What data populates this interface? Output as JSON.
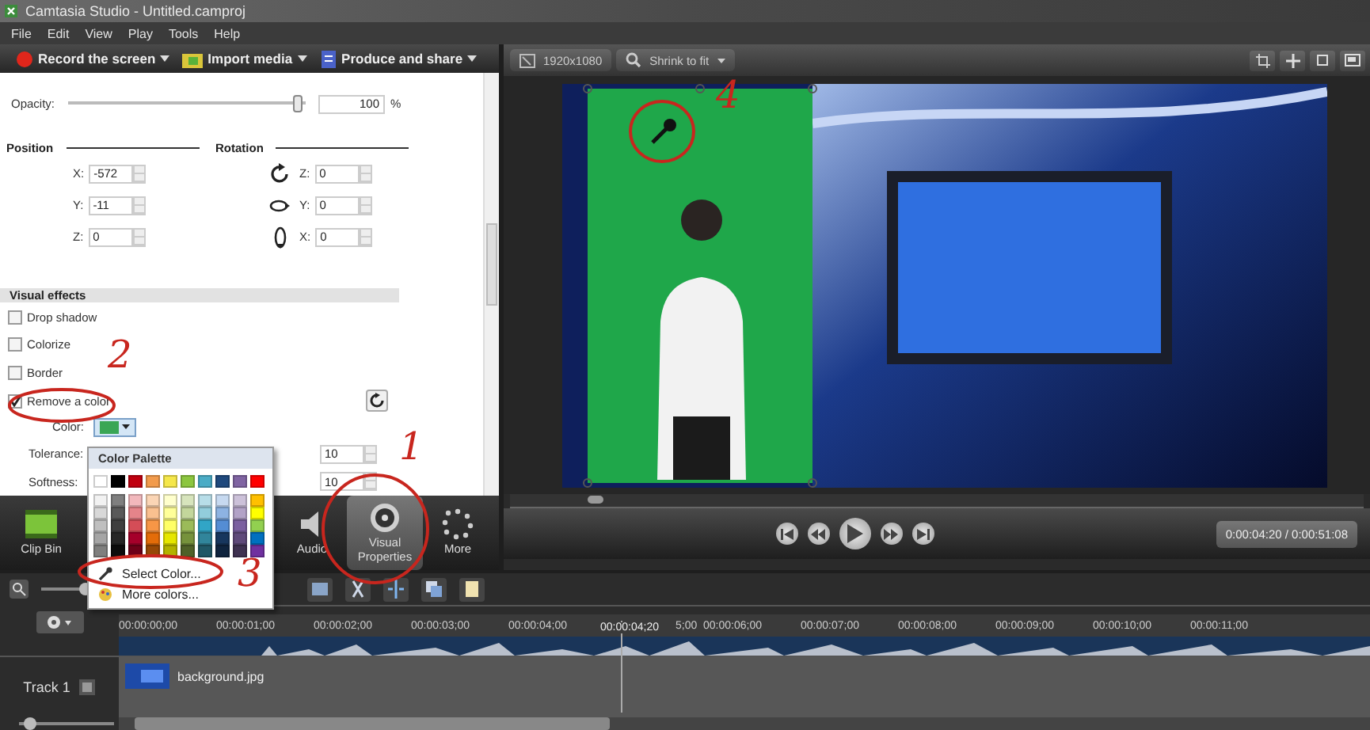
{
  "window": {
    "title": "Camtasia Studio - Untitled.camproj"
  },
  "menu": [
    "File",
    "Edit",
    "View",
    "Play",
    "Tools",
    "Help"
  ],
  "toolbar": [
    {
      "label": "Record the screen",
      "kind": "record"
    },
    {
      "label": "Import media",
      "kind": "import"
    },
    {
      "label": "Produce and share",
      "kind": "produce"
    }
  ],
  "properties": {
    "opacity": {
      "label": "Opacity:",
      "level": 0.97,
      "value": "100",
      "unit": "%"
    },
    "position": {
      "title": "Position",
      "fields": [
        {
          "axis": "X:",
          "value": "-572"
        },
        {
          "axis": "Y:",
          "value": "-11"
        },
        {
          "axis": "Z:",
          "value": "0"
        }
      ]
    },
    "rotation": {
      "title": "Rotation",
      "fields": [
        {
          "axis": "Z:",
          "value": "0"
        },
        {
          "axis": "Y:",
          "value": "0"
        },
        {
          "axis": "X:",
          "value": "0"
        }
      ]
    },
    "visual_effects": {
      "title": "Visual effects",
      "effects": [
        {
          "label": "Drop shadow",
          "checked": false
        },
        {
          "label": "Colorize",
          "checked": false
        },
        {
          "label": "Border",
          "checked": false
        },
        {
          "label": "Remove a color",
          "checked": true
        }
      ],
      "color_label": "Color:",
      "color": "#3aa655",
      "tolerance": {
        "label": "Tolerance:",
        "value": "10"
      },
      "softness": {
        "label": "Softness:",
        "value": "10"
      }
    }
  },
  "palette": {
    "title": "Color Palette",
    "swatches": [
      {
        "color": "#ffffff"
      },
      {
        "color": "#000000"
      },
      {
        "color": "#c0000f"
      },
      {
        "color": "#f29b4c"
      },
      {
        "color": "#f5e74a"
      },
      {
        "color": "#8cc63f"
      },
      {
        "color": "#4bacc6"
      },
      {
        "color": "#1f497d"
      },
      {
        "color": "#8064a2"
      },
      {
        "color": "#ff0000"
      },
      {
        "color": "#f2f2f2"
      },
      {
        "color": "#7f7f7f"
      },
      {
        "color": "#f2b8bc"
      },
      {
        "color": "#fbd5b5"
      },
      {
        "color": "#ffffcc"
      },
      {
        "color": "#d7e4bc"
      },
      {
        "color": "#b7dde8"
      },
      {
        "color": "#c6d9f0"
      },
      {
        "color": "#ccc1d9"
      },
      {
        "color": "#ffc000"
      },
      {
        "color": "#d8d8d8"
      },
      {
        "color": "#595959"
      },
      {
        "color": "#e5848a"
      },
      {
        "color": "#fac08f"
      },
      {
        "color": "#ffff99"
      },
      {
        "color": "#c3d69b"
      },
      {
        "color": "#92cddc"
      },
      {
        "color": "#8db3e2"
      },
      {
        "color": "#b2a2c7"
      },
      {
        "color": "#ffff00"
      },
      {
        "color": "#bfbfbf"
      },
      {
        "color": "#3f3f3f"
      },
      {
        "color": "#d44d57"
      },
      {
        "color": "#f79646"
      },
      {
        "color": "#ffff66"
      },
      {
        "color": "#9bbb59"
      },
      {
        "color": "#31a5c6"
      },
      {
        "color": "#548dd4"
      },
      {
        "color": "#7b5fa0"
      },
      {
        "color": "#92d050"
      },
      {
        "color": "#a5a5a5"
      },
      {
        "color": "#262626"
      },
      {
        "color": "#a5002a"
      },
      {
        "color": "#e36c09"
      },
      {
        "color": "#e6e600"
      },
      {
        "color": "#76923c"
      },
      {
        "color": "#31859b"
      },
      {
        "color": "#17365d"
      },
      {
        "color": "#5f497a"
      },
      {
        "color": "#0070c0"
      },
      {
        "color": "#7f7f7e"
      },
      {
        "color": "#0c0c0c"
      },
      {
        "color": "#6e0018"
      },
      {
        "color": "#974806"
      },
      {
        "color": "#b3b300"
      },
      {
        "color": "#4f6128"
      },
      {
        "color": "#205867"
      },
      {
        "color": "#0f243e"
      },
      {
        "color": "#3f3151"
      },
      {
        "color": "#7030a0"
      }
    ],
    "actions": [
      {
        "label": "Select Color...",
        "kind": "eyedropper"
      },
      {
        "label": "More colors...",
        "kind": "palette"
      }
    ]
  },
  "tasks": [
    {
      "label": "Clip Bin",
      "kind": "clipbin",
      "selected": false
    },
    {
      "label": "Audio",
      "kind": "audio",
      "selected": false
    },
    {
      "label": "Visual Properties",
      "kind": "visual",
      "selected": true
    },
    {
      "label": "More",
      "kind": "more",
      "selected": false
    }
  ],
  "preview": {
    "resolution": "1920x1080",
    "zoom": "Shrink to fit",
    "level": 0.1,
    "time": "0:00:04:20 / 0:00:51:08"
  },
  "timeline": {
    "ticks": [
      "00:00:00;00",
      "00:00:01;00",
      "00:00:02;00",
      "00:00:03;00",
      "00:00:04;00",
      "5;00",
      "00:00:06;00",
      "00:00:07;00",
      "00:00:08;00",
      "00:00:09;00",
      "00:00:10;00",
      "00:00:11;00"
    ],
    "playhead": "00:00:04;20",
    "zoom": {
      "level": 0.25
    },
    "height": {
      "level": 0.12
    },
    "tracks": [
      {
        "name": "Track 1",
        "clip": "background.jpg"
      }
    ]
  },
  "annotations": [
    {
      "text": "4"
    },
    {
      "text": "2"
    },
    {
      "text": "1"
    },
    {
      "text": "3"
    }
  ]
}
